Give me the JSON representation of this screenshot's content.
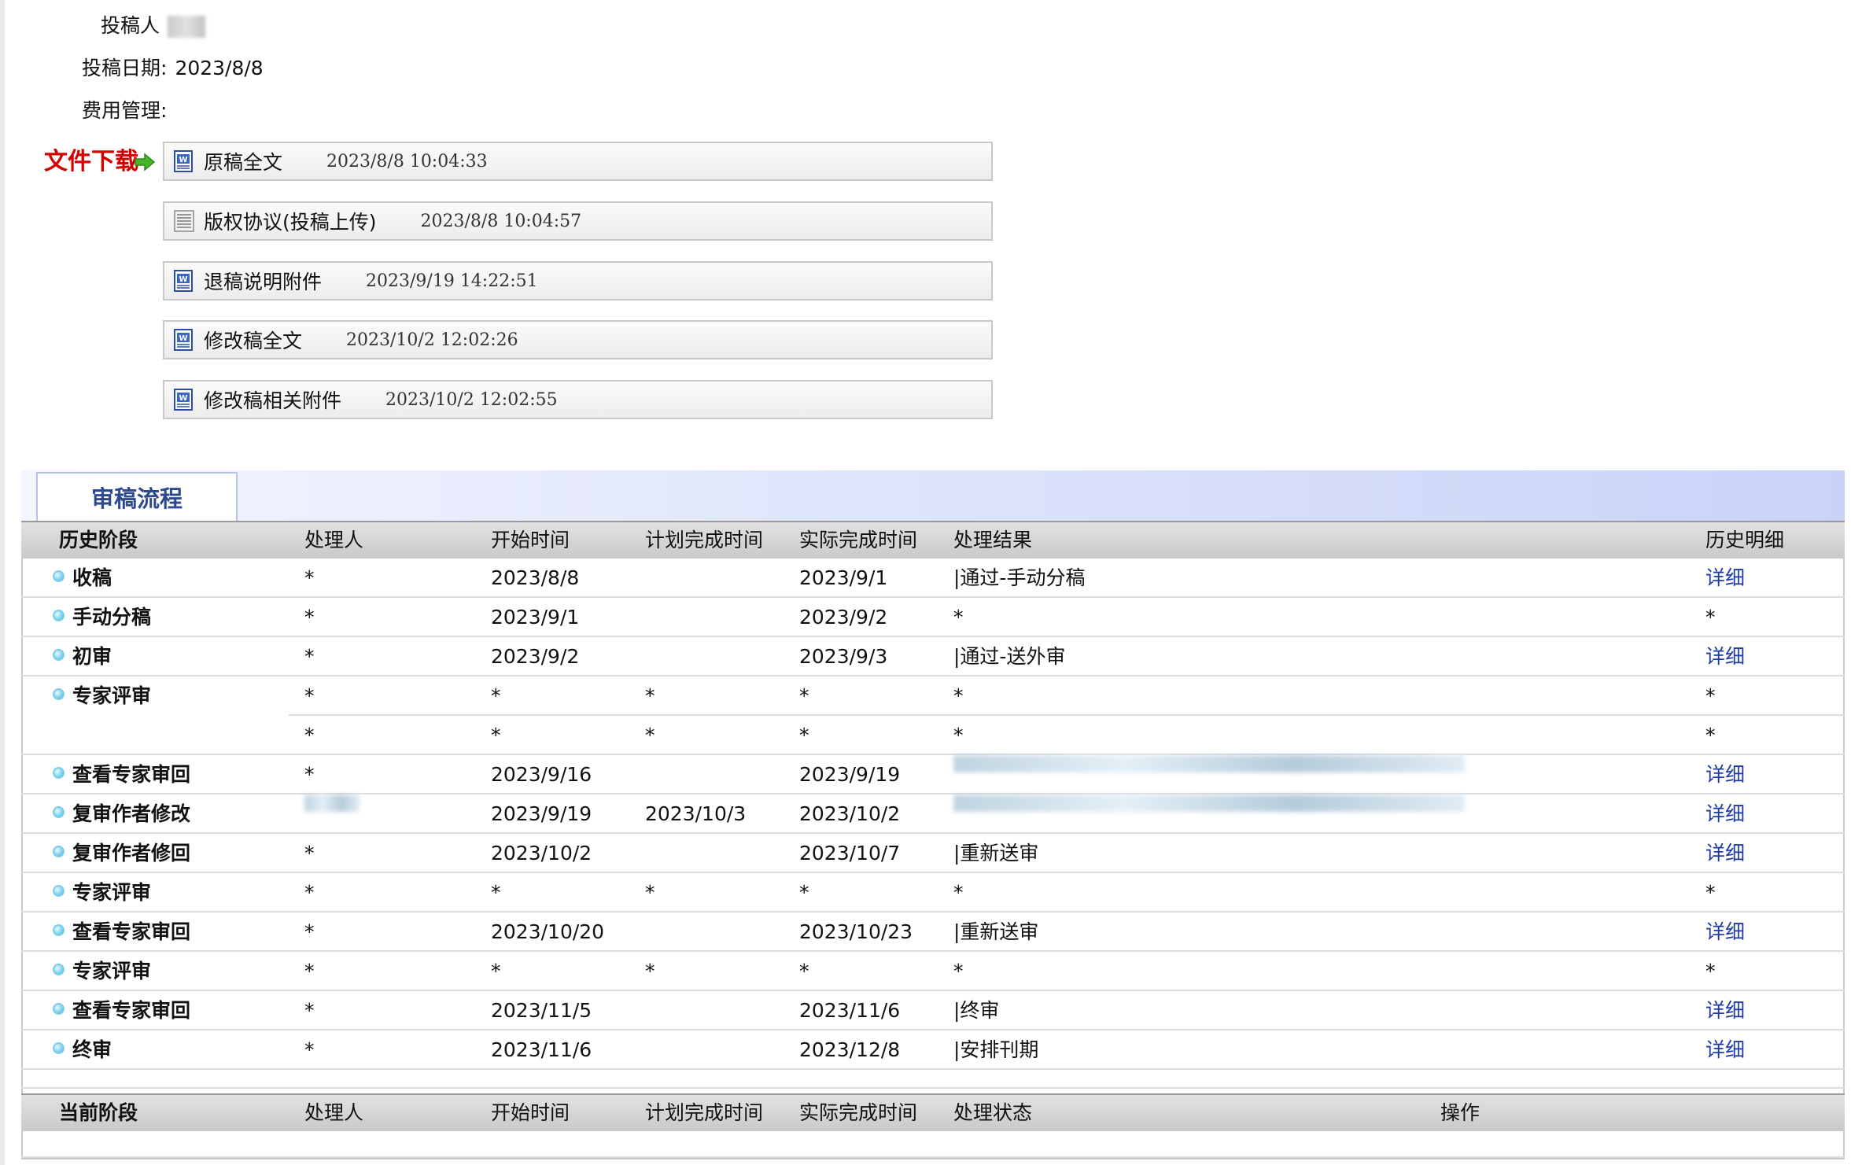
{
  "meta": {
    "submitter_label": "投稿人",
    "date_label": "投稿日期:",
    "date_value": "2023/8/8",
    "fee_label": "费用管理:"
  },
  "download": {
    "label": "文件下载",
    "files": [
      {
        "name": "原稿全文",
        "time": "2023/8/8 10:04:33",
        "icon": "word-doc-icon"
      },
      {
        "name": "版权协议(投稿上传)",
        "time": "2023/8/8 10:04:57",
        "icon": "text-doc-icon"
      },
      {
        "name": "退稿说明附件",
        "time": "2023/9/19 14:22:51",
        "icon": "word-doc-icon"
      },
      {
        "name": "修改稿全文",
        "time": "2023/10/2 12:02:26",
        "icon": "word-doc-icon"
      },
      {
        "name": "修改稿相关附件",
        "time": "2023/10/2 12:02:55",
        "icon": "word-doc-icon"
      }
    ]
  },
  "flow": {
    "tab_label": "审稿流程",
    "history_header": [
      "历史阶段",
      "处理人",
      "开始时间",
      "计划完成时间",
      "实际完成时间",
      "处理结果",
      "历史明细"
    ],
    "history_rows": [
      {
        "stage": "收稿",
        "handler": "*",
        "start": "2023/8/8",
        "plan": "",
        "actual": "2023/9/1",
        "result": "|通过-手动分稿",
        "detail": "详细"
      },
      {
        "stage": "手动分稿",
        "handler": "*",
        "start": "2023/9/1",
        "plan": "",
        "actual": "2023/9/2",
        "result": "*",
        "detail": "*"
      },
      {
        "stage": "初审",
        "handler": "*",
        "start": "2023/9/2",
        "plan": "",
        "actual": "2023/9/3",
        "result": "|通过-送外审",
        "detail": "详细"
      },
      {
        "stage": "专家评审",
        "handler": "*",
        "start": "*",
        "plan": "*",
        "actual": "*",
        "result": "*",
        "detail": "*"
      },
      {
        "stage": "",
        "handler": "*",
        "start": "*",
        "plan": "*",
        "actual": "*",
        "result": "*",
        "detail": "*"
      },
      {
        "stage": "查看专家审回",
        "handler": "*",
        "start": "2023/9/16",
        "plan": "",
        "actual": "2023/9/19",
        "result": "",
        "detail": "详细"
      },
      {
        "stage": "复审作者修改",
        "handler": "",
        "start": "2023/9/19",
        "plan": "2023/10/3",
        "actual": "2023/10/2",
        "result": "",
        "detail": "详细"
      },
      {
        "stage": "复审作者修回",
        "handler": "*",
        "start": "2023/10/2",
        "plan": "",
        "actual": "2023/10/7",
        "result": "|重新送审",
        "detail": "详细"
      },
      {
        "stage": "专家评审",
        "handler": "*",
        "start": "*",
        "plan": "*",
        "actual": "*",
        "result": "*",
        "detail": "*"
      },
      {
        "stage": "查看专家审回",
        "handler": "*",
        "start": "2023/10/20",
        "plan": "",
        "actual": "2023/10/23",
        "result": "|重新送审",
        "detail": "详细"
      },
      {
        "stage": "专家评审",
        "handler": "*",
        "start": "*",
        "plan": "*",
        "actual": "*",
        "result": "*",
        "detail": "*"
      },
      {
        "stage": "查看专家审回",
        "handler": "*",
        "start": "2023/11/5",
        "plan": "",
        "actual": "2023/11/6",
        "result": "|终审",
        "detail": "详细"
      },
      {
        "stage": "终审",
        "handler": "*",
        "start": "2023/11/6",
        "plan": "",
        "actual": "2023/12/8",
        "result": "|安排刊期",
        "detail": "详细"
      }
    ],
    "current_header": [
      "当前阶段",
      "处理人",
      "开始时间",
      "计划完成时间",
      "实际完成时间",
      "处理状态",
      "操作"
    ]
  },
  "colors": {
    "download_label": "#d40000",
    "link": "#1f3aa8",
    "tab_text": "#2e4a8e"
  }
}
